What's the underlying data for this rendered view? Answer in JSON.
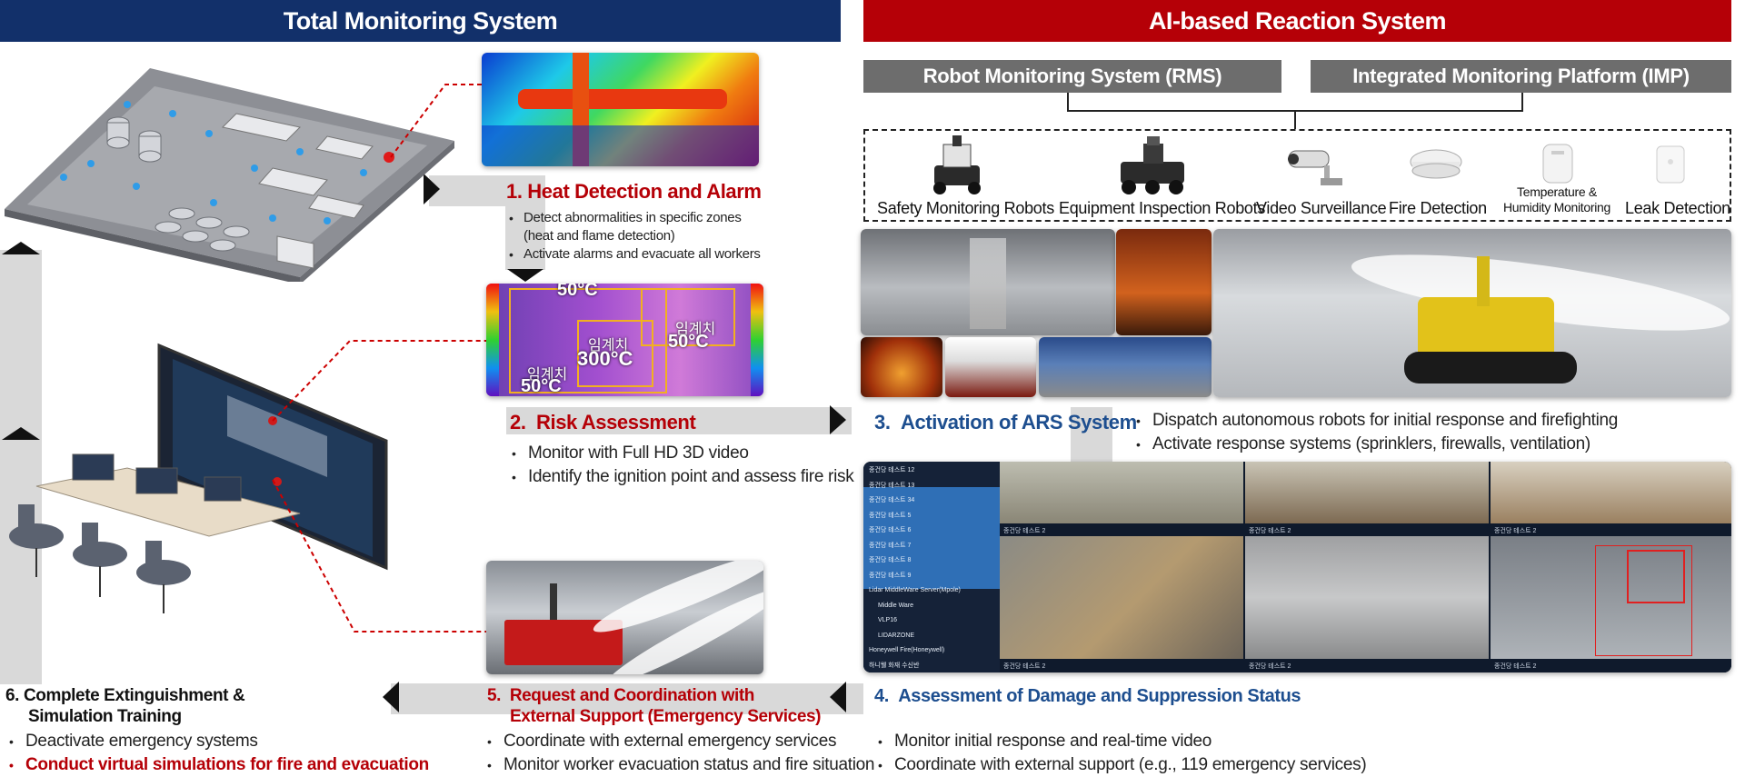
{
  "headers": {
    "left": "Total Monitoring System",
    "right": "AI-based Reaction System"
  },
  "systems": {
    "rms": "Robot Monitoring System (RMS)",
    "imp": "Integrated Monitoring Platform (IMP)"
  },
  "devices": [
    {
      "icon": "safety-robot-icon",
      "label": "Safety Monitoring Robots"
    },
    {
      "icon": "inspection-robot-icon",
      "label": "Equipment Inspection Robots"
    },
    {
      "icon": "cctv-camera-icon",
      "label": "Video Surveillance"
    },
    {
      "icon": "smoke-detector-icon",
      "label": "Fire Detection"
    },
    {
      "icon": "humidity-sensor-icon",
      "label_line1": "Temperature &",
      "label_line2": "Humidity Monitoring"
    },
    {
      "icon": "leak-sensor-icon",
      "label": "Leak Detection"
    }
  ],
  "thermal": {
    "t1": "50°C",
    "t2_label": "임계치",
    "t2": "300°C",
    "t3_label": "임계치",
    "t3": "50°C",
    "t4_label": "임계치",
    "t4": "50°C"
  },
  "steps": {
    "s1": {
      "number": "1.",
      "title": "Heat Detection and Alarm",
      "b1_line1": "Detect abnormalities in specific zones",
      "b1_line2": "(heat and flame detection)",
      "b2": "Activate alarms and evacuate all workers"
    },
    "s2": {
      "number": "2.",
      "title": "Risk Assessment",
      "b1": "Monitor with Full HD 3D video",
      "b2": "Identify the ignition point and assess fire risk"
    },
    "s3": {
      "number": "3.",
      "title": "Activation of ARS System",
      "b1": "Dispatch autonomous robots for initial response and firefighting",
      "b2": "Activate response systems (sprinklers, firewalls, ventilation)"
    },
    "s4": {
      "number": "4.",
      "title": "Assessment of Damage and Suppression Status",
      "b1": "Monitor initial response and real-time video",
      "b2": "Coordinate with external support (e.g., 119 emergency services)"
    },
    "s5": {
      "number": "5.",
      "title_line1": "Request and Coordination with",
      "title_line2": "External Support (Emergency Services)",
      "b1": "Coordinate with external emergency services",
      "b2": "Monitor worker evacuation status and fire situation"
    },
    "s6": {
      "number": "6.",
      "title_line1": "Complete Extinguishment &",
      "title_line2": "Simulation Training",
      "b1": "Deactivate emergency systems",
      "b2": "Conduct virtual simulations for fire and evacuation"
    }
  },
  "vms": {
    "tree": [
      "종건당 테스트 12",
      "종건당 테스트 13",
      "종건당 테스트 34",
      "종건당 테스트 5",
      "종건당 테스트 6",
      "종건당 테스트 7",
      "종건당 테스트 8",
      "종건당 테스트 9",
      "Lidar MiddleWare Server(Mpole)",
      "Middle Ware",
      "VLP16",
      "LIDARZONE",
      "Honeywell Fire(Honeywell)",
      "하니웰 화재 수신반"
    ],
    "cam_label": "종건당 테스트 2"
  },
  "colors": {
    "navy": "#12306a",
    "red": "#b50007",
    "grey": "#6d6d6d",
    "band": "#d9d9d9",
    "blue_title": "#1d4e8f"
  }
}
